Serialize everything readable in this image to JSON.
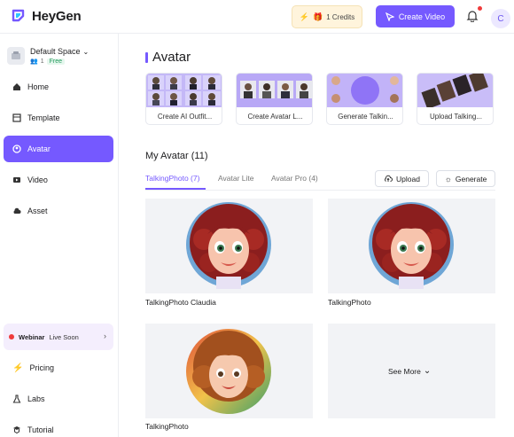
{
  "header": {
    "app_name": "HeyGen",
    "credits_label": "1 Credits",
    "create_video_label": "Create Video",
    "profile_initial": "C"
  },
  "sidebar": {
    "space_name": "Default Space",
    "member_count": "1",
    "plan_badge": "Free",
    "nav": [
      {
        "label": "Home",
        "icon": "home-icon",
        "active": false
      },
      {
        "label": "Template",
        "icon": "template-icon",
        "active": false
      },
      {
        "label": "Avatar",
        "icon": "avatar-icon",
        "active": true
      },
      {
        "label": "Video",
        "icon": "video-icon",
        "active": false
      },
      {
        "label": "Asset",
        "icon": "cloud-icon",
        "active": false
      }
    ],
    "webinar": {
      "title": "Webinar",
      "status": "Live Soon"
    },
    "bottom_nav": [
      {
        "label": "Pricing",
        "icon": "pricing-icon"
      },
      {
        "label": "Labs",
        "icon": "flask-icon"
      },
      {
        "label": "Tutorial",
        "icon": "tutorial-icon"
      }
    ]
  },
  "main": {
    "title": "Avatar",
    "cards": [
      {
        "label": "Create AI Outfit..."
      },
      {
        "label": "Create Avatar L..."
      },
      {
        "label": "Generate Talkin..."
      },
      {
        "label": "Upload Talking..."
      }
    ],
    "my_avatar_title": "My Avatar (11)",
    "tabs": [
      {
        "label": "TalkingPhoto (7)",
        "active": true
      },
      {
        "label": "Avatar Lite",
        "active": false
      },
      {
        "label": "Avatar Pro (4)",
        "active": false
      }
    ],
    "upload_label": "Upload",
    "generate_label": "Generate",
    "tiles": [
      {
        "label": "TalkingPhoto Claudia"
      },
      {
        "label": "TalkingPhoto"
      },
      {
        "label": "TalkingPhoto"
      }
    ],
    "see_more_label": "See More"
  },
  "colors": {
    "accent": "#7559ff",
    "credits_bg": "#fff4dc",
    "notification_dot": "#ef3b3b"
  }
}
